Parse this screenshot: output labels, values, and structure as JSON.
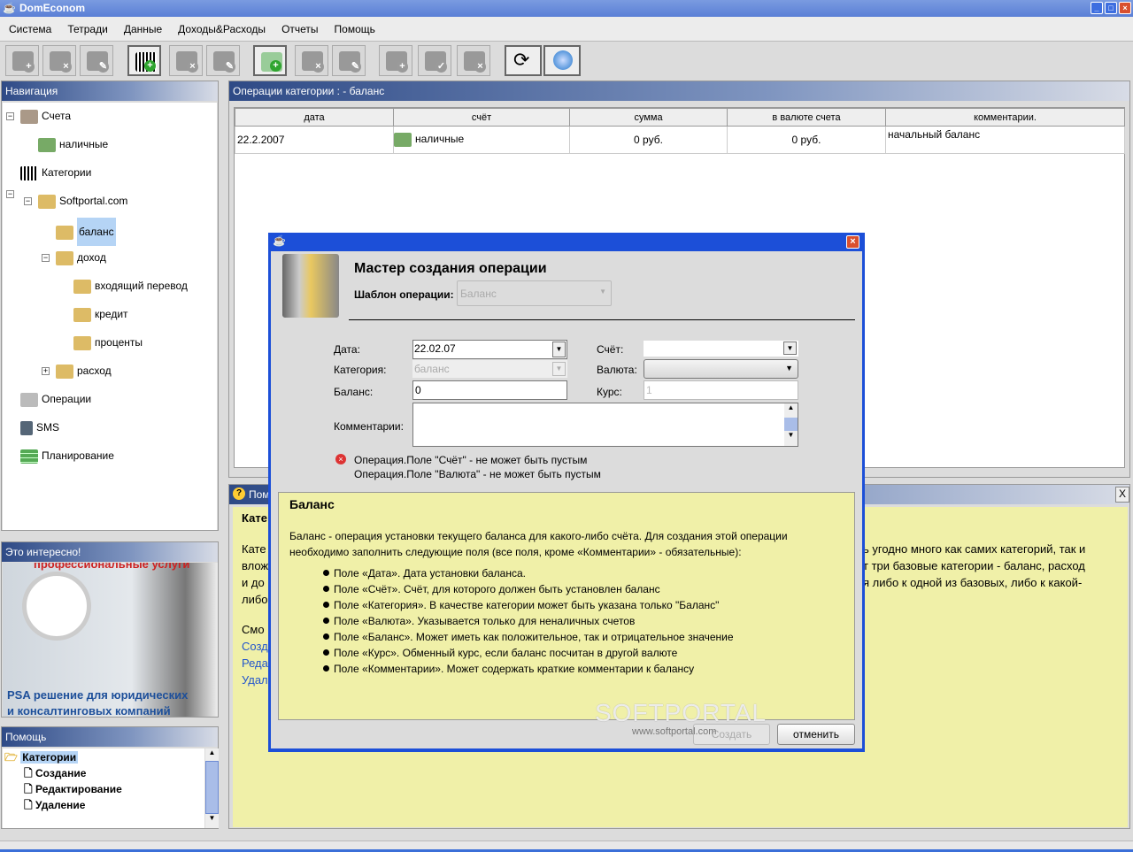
{
  "app": {
    "title": "DomEconom"
  },
  "menu": [
    "Система",
    "Тетради",
    "Данные",
    "Доходы&Расходы",
    "Отчеты",
    "Помощь"
  ],
  "toolbar": {
    "buttons": [
      "add-account",
      "delete-account",
      "edit-account",
      "add-category",
      "delete-category",
      "edit-category",
      "add-operation",
      "delete-operation",
      "edit-operation",
      "add-plan",
      "edit-plan",
      "delete-plan",
      "refresh",
      "help"
    ]
  },
  "nav": {
    "title": "Навигация",
    "items": [
      "Счета",
      "наличные",
      "Категории",
      "Softportal.com",
      "баланс",
      "доход",
      "входящий перевод",
      "кредит",
      "проценты",
      "расход",
      "Операции",
      "SMS",
      "Планирование"
    ]
  },
  "interesting": {
    "title": "Это интересно!",
    "ad_top": "профессиональные услуги",
    "ad_line1": "PSA решение для юридических",
    "ad_line2": "и консалтинговых компаний"
  },
  "help_nav": {
    "title": "Помощь",
    "items": [
      "Категории",
      "Создание",
      "Редактирование",
      "Удаление"
    ]
  },
  "operations": {
    "title": "Операции категории : - баланс",
    "columns": [
      "дата",
      "счёт",
      "сумма",
      "в валюте счета",
      "комментарии."
    ],
    "rows": [
      [
        "22.2.2007",
        "наличные",
        "0 руб.",
        "0 руб.",
        "начальный баланс"
      ]
    ]
  },
  "help_panel": {
    "title_fragment": "Пом",
    "left_fragments": [
      "Кате",
      "Кате",
      "влож",
      "и до",
      "либо",
      "Смо",
      "Созд",
      "Реда",
      "Удал"
    ],
    "right_fragments": [
      "ь угодно много как самих категорий, так и",
      "т три базовые категории - баланс, расход",
      "я либо к одной из базовых, либо к какой-"
    ],
    "close": "X"
  },
  "dialog": {
    "heading": "Мастер создания операции",
    "template_label": "Шаблон операции:",
    "template_value": "Баланс",
    "fields": {
      "date_label": "Дата:",
      "date_value": "22.02.07",
      "category_label": "Категория:",
      "category_value": "баланс",
      "balance_label": "Баланс:",
      "balance_value": "0",
      "comment_label": "Комментарии:",
      "account_label": "Счёт:",
      "account_value": "",
      "currency_label": "Валюта:",
      "currency_value": "",
      "rate_label": "Курс:",
      "rate_value": "1"
    },
    "errors": [
      "Операция.Поле \"Счёт\" -  не может быть пустым",
      "Операция.Поле \"Валюта\" -  не может быть пустым"
    ],
    "help_title": "Баланс",
    "help_text1": "Баланс - операция установки текущего баланса для какого-либо счёта. Для создания этой операции",
    "help_text2": "необходимо заполнить следующие поля (все поля, кроме «Комментарии» - обязательные):",
    "bullets": [
      "Поле «Дата». Дата установки баланса.",
      "Поле «Счёт». Счёт, для которого должен быть установлен баланс",
      "Поле «Категория». В качестве категории может быть указана только \"Баланс\"",
      "Поле «Валюта». Указывается только для неналичных счетов",
      "Поле «Баланс». Может иметь как положительное, так и отрицательное значение",
      "Поле «Курс». Обменный курс, если баланс посчитан в другой валюте",
      "Поле «Комментарии». Может содержать краткие комментарии к балансу"
    ],
    "create": "Создать",
    "cancel": "отменить"
  },
  "watermark": {
    "logo": "SOFTPORTAL",
    "url": "www.softportal.com"
  },
  "colors": {
    "title_blue": "#1c4fd8",
    "panel_header": "#2e4a86",
    "help_yellow": "#f0f0a8",
    "error_red": "#d33"
  }
}
